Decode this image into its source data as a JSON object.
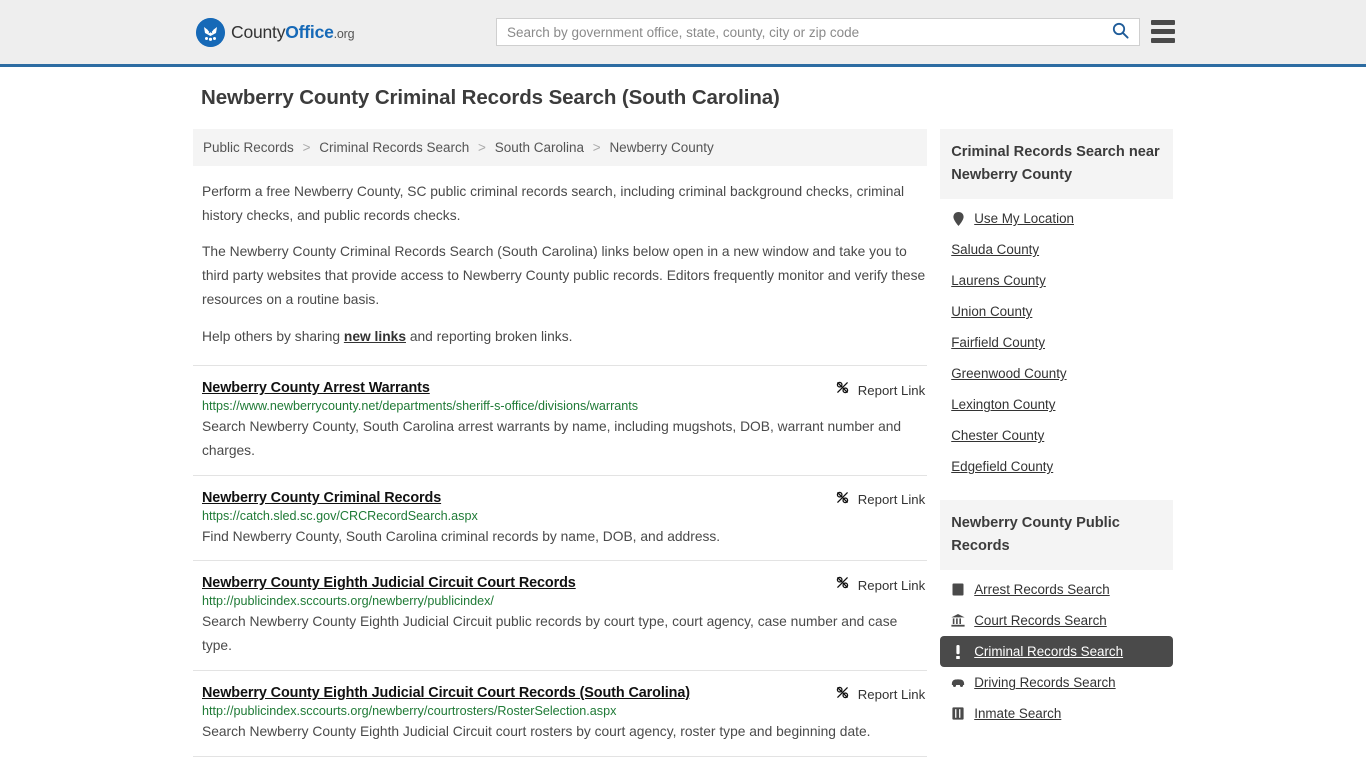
{
  "header": {
    "logo_name_part1": "County",
    "logo_name_part2": "Office",
    "logo_tld": ".org",
    "search_placeholder": "Search by government office, state, county, city or zip code",
    "search_value": "",
    "search_icon": "search-icon",
    "menu_icon": "hamburger-menu-icon"
  },
  "page": {
    "title": "Newberry County Criminal Records Search (South Carolina)"
  },
  "breadcrumb": {
    "items": [
      {
        "label": "Public Records"
      },
      {
        "label": "Criminal Records Search"
      },
      {
        "label": "South Carolina"
      },
      {
        "label": "Newberry County"
      }
    ],
    "separator": ">"
  },
  "intro": {
    "p1": "Perform a free Newberry County, SC public criminal records search, including criminal background checks, criminal history checks, and public records checks.",
    "p2": "The Newberry County Criminal Records Search (South Carolina) links below open in a new window and take you to third party websites that provide access to Newberry County public records. Editors frequently monitor and verify these resources on a routine basis.",
    "p3_before": "Help others by sharing ",
    "p3_link": "new links",
    "p3_after": " and reporting broken links."
  },
  "results": {
    "report_label": "Report Link",
    "report_icon": "broken-link-icon",
    "items": [
      {
        "title": "Newberry County Arrest Warrants",
        "url": "https://www.newberrycounty.net/departments/sheriff-s-office/divisions/warrants",
        "description": "Search Newberry County, South Carolina arrest warrants by name, including mugshots, DOB, warrant number and charges."
      },
      {
        "title": "Newberry County Criminal Records",
        "url": "https://catch.sled.sc.gov/CRCRecordSearch.aspx",
        "description": "Find Newberry County, South Carolina criminal records by name, DOB, and address."
      },
      {
        "title": "Newberry County Eighth Judicial Circuit Court Records",
        "url": "http://publicindex.sccourts.org/newberry/publicindex/",
        "description": "Search Newberry County Eighth Judicial Circuit public records by court type, court agency, case number and case type."
      },
      {
        "title": "Newberry County Eighth Judicial Circuit Court Records (South Carolina)",
        "url": "http://publicindex.sccourts.org/newberry/courtrosters/RosterSelection.aspx",
        "description": "Search Newberry County Eighth Judicial Circuit court rosters by court agency, roster type and beginning date."
      }
    ]
  },
  "sidebar": {
    "nearby": {
      "heading": "Criminal Records Search near Newberry County",
      "items": [
        {
          "label": "Use My Location",
          "icon": "map-pin-icon",
          "active": false
        },
        {
          "label": "Saluda County",
          "icon": "",
          "active": false
        },
        {
          "label": "Laurens County",
          "icon": "",
          "active": false
        },
        {
          "label": "Union County",
          "icon": "",
          "active": false
        },
        {
          "label": "Fairfield County",
          "icon": "",
          "active": false
        },
        {
          "label": "Greenwood County",
          "icon": "",
          "active": false
        },
        {
          "label": "Lexington County",
          "icon": "",
          "active": false
        },
        {
          "label": "Chester County",
          "icon": "",
          "active": false
        },
        {
          "label": "Edgefield County",
          "icon": "",
          "active": false
        }
      ]
    },
    "public_records": {
      "heading": "Newberry County Public Records",
      "items": [
        {
          "label": "Arrest Records Search",
          "icon": "square-icon",
          "active": false
        },
        {
          "label": "Court Records Search",
          "icon": "courthouse-icon",
          "active": false
        },
        {
          "label": "Criminal Records Search",
          "icon": "exclamation-icon",
          "active": true
        },
        {
          "label": "Driving Records Search",
          "icon": "car-icon",
          "active": false
        },
        {
          "label": "Inmate Search",
          "icon": "jail-icon",
          "active": false
        }
      ]
    }
  },
  "colors": {
    "brand_blue": "#1669b7",
    "header_border": "#2d6ca2",
    "url_green": "#1f7a36",
    "active_bg": "#4a4a4a",
    "panel_gray": "#f4f4f4"
  }
}
